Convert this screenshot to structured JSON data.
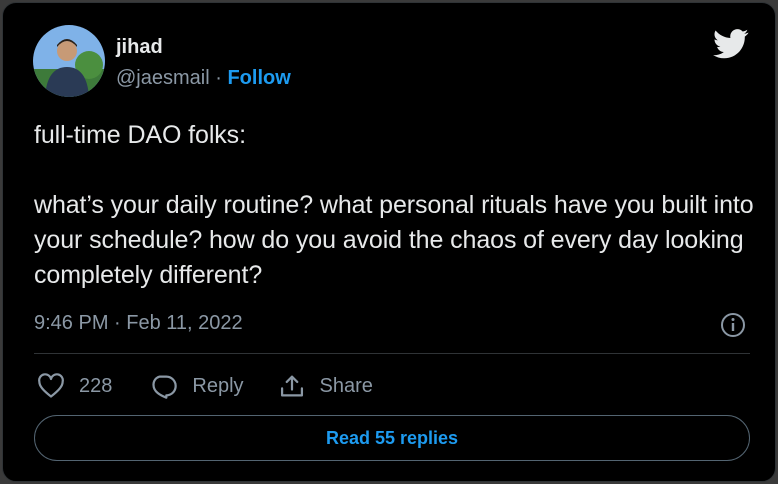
{
  "author": {
    "name": "jihad",
    "handle": "@jaesmail",
    "separator": "·",
    "follow_label": "Follow"
  },
  "tweet": {
    "paragraphs": [
      "full-time DAO folks:",
      "what’s your daily routine? what personal rituals have you built into your schedule? how do you avoid the chaos of every day looking completely different?"
    ],
    "timestamp": "9:46 PM · Feb 11, 2022"
  },
  "actions": {
    "like_count": "228",
    "reply_label": "Reply",
    "share_label": "Share"
  },
  "read_replies_label": "Read 55 replies",
  "icons": {
    "brand": "twitter-bird-icon",
    "info": "info-icon",
    "like": "heart-icon",
    "reply": "speech-bubble-icon",
    "share": "share-upload-icon"
  },
  "colors": {
    "background": "#000000",
    "text": "#e7e9ea",
    "secondary": "#8b98a5",
    "accent": "#1d9bf0"
  }
}
